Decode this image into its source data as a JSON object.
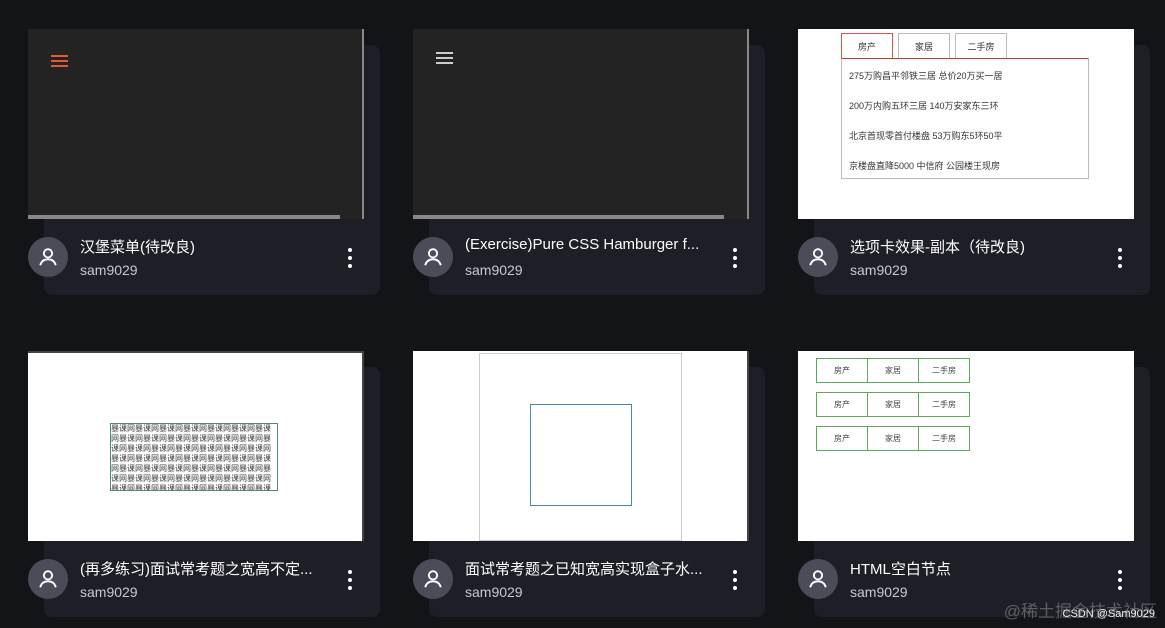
{
  "colors": {
    "page_background": "#131417",
    "card_background": "#1e1f26",
    "burger_active": "#e05a3a",
    "burger_default": "#cccccc"
  },
  "cards": [
    {
      "title": "汉堡菜单(待改良)",
      "author": "sam9029"
    },
    {
      "title": "(Exercise)Pure CSS Hamburger f...",
      "author": "sam9029"
    },
    {
      "title": "选项卡效果-副本（待改良)",
      "author": "sam9029",
      "preview": {
        "tabs": [
          "房产",
          "家居",
          "二手房"
        ],
        "items": [
          "275万购昌平邻铁三居 总价20万买一居",
          "200万内购五环三居 140万安家东三环",
          "北京首现零首付楼盘 53万购东5环50平",
          "京楼盘直降5000 中信府 公园楼王现房"
        ]
      }
    },
    {
      "title": "(再多练习)面试常考题之宽高不定...",
      "author": "sam9029",
      "preview": {
        "text": "暴课网暴课网暴课网暴课网暴课网暴课网暴课网暴课网暴课网暴课网暴课网暴课网暴课网暴课网暴课网暴课网暴课网暴课网暴课网暴课网暴课网暴课网暴课网暴课网暴课网暴课网暴课网暴课网暴课网暴课网暴课网暴课网暴课网暴课网暴课网暴课网暴课网暴课网暴课网暴课网暴课网暴课网暴课网暴课网暴课网暴课网暴课网暴课网暴课网暴课网暴课网暴课网暴课网暴课网暴课网暴课网暴课网暴课网暴课网暴课网"
      }
    },
    {
      "title": "面试常考题之已知宽高实现盒子水...",
      "author": "sam9029"
    },
    {
      "title": "HTML空白节点",
      "author": "sam9029",
      "preview": {
        "rows": [
          [
            "房产",
            "家居",
            "二手房"
          ],
          [
            "房产",
            "家居",
            "二手房"
          ],
          [
            "房产",
            "家居",
            "二手房"
          ]
        ]
      }
    }
  ],
  "watermark": {
    "text": "CSDN @Sam9029",
    "faint_text": "@稀土掘金技术社区"
  }
}
